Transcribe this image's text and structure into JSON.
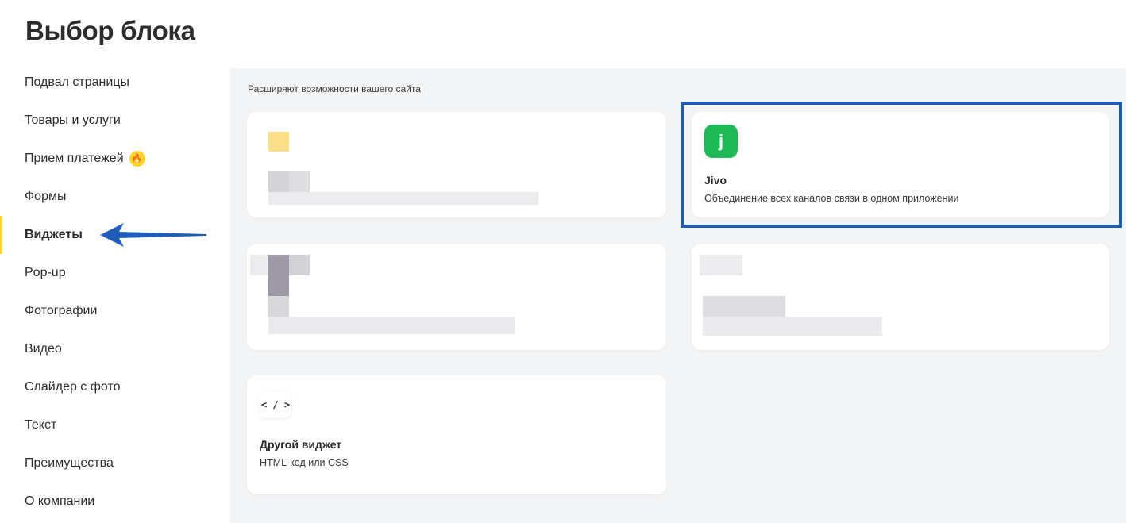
{
  "header": {
    "title": "Выбор блока"
  },
  "sidebar": {
    "items": [
      {
        "label": "Подвал страницы"
      },
      {
        "label": "Товары и услуги"
      },
      {
        "label": "Прием платежей",
        "badge_icon": "fire-icon"
      },
      {
        "label": "Формы"
      },
      {
        "label": "Виджеты",
        "active": true
      },
      {
        "label": "Pop-up"
      },
      {
        "label": "Фотографии"
      },
      {
        "label": "Видео"
      },
      {
        "label": "Слайдер с фото"
      },
      {
        "label": "Текст"
      },
      {
        "label": "Преимущества"
      },
      {
        "label": "О компании"
      }
    ]
  },
  "main": {
    "section_label": "Расширяют возможности вашего сайта",
    "cards": {
      "jivo": {
        "icon": "jivo-logo-icon",
        "icon_glyph": "j",
        "title": "Jivo",
        "description": "Объединение всех каналов связи в одном приложении"
      },
      "custom_widget": {
        "icon": "code-icon",
        "icon_glyph": "< / >",
        "title": "Другой виджет",
        "description": "HTML-код или CSS"
      }
    }
  },
  "colors": {
    "accent_yellow": "#ffd22e",
    "jivo_green": "#20b957",
    "highlight_blue": "#1f5cb8",
    "arrow_blue": "#1f5cb8",
    "main_background": "#f3f4f5"
  }
}
